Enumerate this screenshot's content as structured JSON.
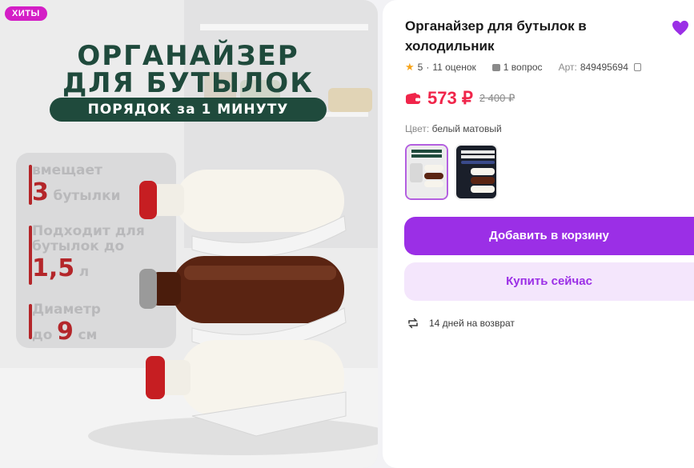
{
  "media": {
    "badge": "ХИТЫ",
    "headline_line1": "ОРГАНАЙЗЕР",
    "headline_line2": "ДЛЯ БУТЫЛОК",
    "pill": "ПОРЯДОК за 1 МИНУТУ",
    "stats": [
      {
        "text": "вмещает",
        "number": "3",
        "suffix": "бутылки"
      },
      {
        "text_line1": "Подходит для",
        "text_line2": "бутылок до",
        "number": "1,5",
        "unit": "л"
      },
      {
        "text": "Диаметр",
        "prefix": "до",
        "number": "9",
        "unit": "см"
      }
    ],
    "accent_color": "#b4262a",
    "headline_color": "#1f4a3c"
  },
  "product": {
    "title": "Органайзер для бутылок в холодильник",
    "rating": "5",
    "reviews": "11 оценок",
    "questions": "1 вопрос",
    "article_label": "Арт:",
    "article": "849495694",
    "price": "573 ₽",
    "old_price": "2 400 ₽",
    "color_label": "Цвет:",
    "color_value": "белый матовый",
    "thumbnails": [
      "white",
      "dark"
    ],
    "add_to_cart": "Добавить в корзину",
    "buy_now": "Купить сейчас",
    "return_policy": "14 дней на возврат",
    "brand_color": "#9b2fe6",
    "price_color": "#f0254a"
  }
}
